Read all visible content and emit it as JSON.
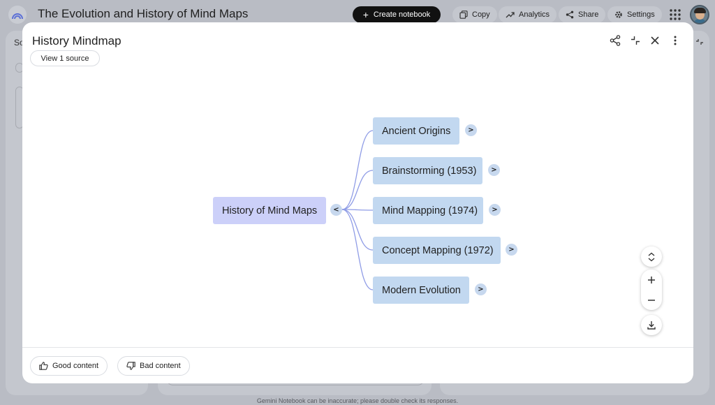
{
  "app": {
    "title": "The Evolution and History of Mind Maps",
    "create_label": "Create notebook",
    "copy_label": "Copy",
    "analytics_label": "Analytics",
    "share_label": "Share",
    "settings_label": "Settings",
    "left_panel_label": "So",
    "disclaimer": "Gemini Notebook can be inaccurate; please double check its responses."
  },
  "modal": {
    "title": "History Mindmap",
    "view_source_label": "View 1 source",
    "icons": [
      "share-icon",
      "collapse-icon",
      "close-icon",
      "more-vert-icon"
    ],
    "feedback": {
      "good_label": "Good content",
      "bad_label": "Bad content"
    }
  },
  "mindmap": {
    "root": {
      "label": "History of Mind Maps",
      "toggle": "<"
    },
    "children": [
      {
        "label": "Ancient Origins",
        "toggle": ">"
      },
      {
        "label": "Brainstorming (1953)",
        "toggle": ">"
      },
      {
        "label": "Mind Mapping (1974)",
        "toggle": ">"
      },
      {
        "label": "Concept Mapping (1972)",
        "toggle": ">"
      },
      {
        "label": "Modern Evolution",
        "toggle": ">"
      }
    ]
  },
  "colors": {
    "root_node": "#ccd0f9",
    "child_node": "#c2d8f0",
    "connector": "#8f9ce6",
    "toggle": "#c7d8ee",
    "overlay_bg": "#b9bcc4"
  }
}
